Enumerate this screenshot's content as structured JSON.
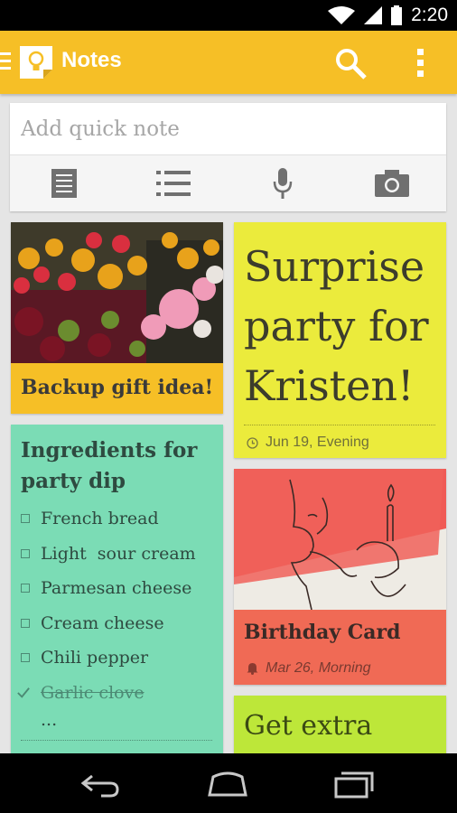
{
  "status_bar": {
    "time": "2:20",
    "icons": [
      "wifi-icon",
      "signal-icon",
      "battery-icon"
    ]
  },
  "app_bar": {
    "title": "Notes",
    "icons": [
      "drawer-icon",
      "keep-logo-icon",
      "search-icon",
      "overflow-menu-icon"
    ],
    "color": "#f6bf26"
  },
  "quick_note": {
    "placeholder": "Add quick note",
    "tools": [
      "text-note-icon",
      "list-note-icon",
      "microphone-icon",
      "camera-icon"
    ]
  },
  "notes": {
    "gift": {
      "title": "Backup gift idea!",
      "color": "#f6bf26",
      "image": "flower-market-photo"
    },
    "party": {
      "title": "Surprise party for Kristen!",
      "reminder": "Jun 19, Evening",
      "color": "#ebeb3c"
    },
    "dip": {
      "title": "Ingredients for party dip",
      "color": "#7bdcb5",
      "items": [
        {
          "text": "French bread",
          "checked": false
        },
        {
          "text": "Light  sour cream",
          "checked": false
        },
        {
          "text": "Parmesan cheese",
          "checked": false
        },
        {
          "text": "Cream cheese",
          "checked": false
        },
        {
          "text": "Chili pepper",
          "checked": false
        },
        {
          "text": "Garlic clove",
          "checked": true
        }
      ],
      "more": "..."
    },
    "birthday": {
      "title": "Birthday Card",
      "reminder": "Mar 26, Morning",
      "color": "#f06a55",
      "image": "cupcake-sketch-drawing"
    },
    "extra": {
      "title": "Get extra",
      "color": "#bde739"
    }
  },
  "nav_bar": {
    "icons": [
      "back-icon",
      "home-icon",
      "recents-icon"
    ]
  }
}
